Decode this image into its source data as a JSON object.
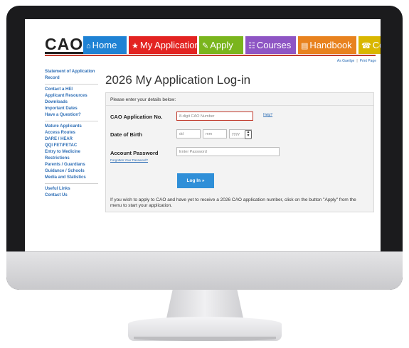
{
  "logo": "CAO",
  "nav": [
    {
      "label": "Home",
      "icon": "⌂",
      "color": "#1f82d4"
    },
    {
      "label": "My Application",
      "icon": "★",
      "color": "#e32321"
    },
    {
      "label": "Apply",
      "icon": "✎",
      "color": "#7ab51d"
    },
    {
      "label": "Courses",
      "icon": "☷",
      "color": "#8e55c4"
    },
    {
      "label": "Handbook",
      "icon": "▤",
      "color": "#e8821e"
    },
    {
      "label": "Contact",
      "icon": "☎",
      "color": "#d9b700"
    }
  ],
  "lang_links": {
    "irish": "As Gaeilge",
    "print": "Print Page"
  },
  "sidebar": [
    [
      "Statement of Application Record"
    ],
    [
      "Contact a HEI",
      "Applicant Resources",
      "Downloads",
      "Important Dates",
      "Have a Question?"
    ],
    [
      "Mature Applicants",
      "Access Routes",
      "DARE / HEAR",
      "QQI FET/FETAC",
      "Entry to Medicine",
      "Restrictions",
      "Parents / Guardians",
      "Guidance / Schools",
      "Media and Statistics"
    ],
    [
      "Useful Links",
      "Contact Us"
    ]
  ],
  "page_title": "2026 My Application Log-in",
  "form": {
    "intro": "Please enter your details below:",
    "app_no_label": "CAO Application No.",
    "app_no_placeholder": "8-digit CAO Number",
    "help_link": "Help?",
    "dob_label": "Date of Birth",
    "dd_placeholder": "dd",
    "mm_placeholder": "mm",
    "yyyy_placeholder": "yyyy",
    "password_label": "Account Password",
    "password_placeholder": "Enter Password",
    "forgot_link": "Forgotten Your Password?",
    "login_button": "Log In »",
    "note": "If you wish to apply to CAO and have yet to receive a 2026 CAO application number, click on the button \"Apply\" from the menu to start your application."
  }
}
